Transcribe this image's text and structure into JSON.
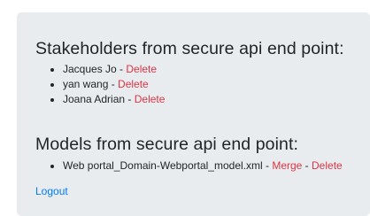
{
  "stakeholders": {
    "heading": "Stakeholders from secure api end point:",
    "items": [
      {
        "name": "Jacques Jo",
        "separator": " - ",
        "delete_label": "Delete"
      },
      {
        "name": "yan wang",
        "separator": " - ",
        "delete_label": "Delete"
      },
      {
        "name": "Joana Adrian",
        "separator": " - ",
        "delete_label": "Delete"
      }
    ]
  },
  "models": {
    "heading": "Models from secure api end point:",
    "items": [
      {
        "name": "Web portal_Domain-Webportal_model.xml",
        "separator1": " - ",
        "merge_label": "Merge",
        "separator2": " - ",
        "delete_label": "Delete"
      }
    ]
  },
  "logout_label": "Logout",
  "colors": {
    "panel_background": "#e9ecef",
    "text": "#212529",
    "danger_link": "#dc3545",
    "primary_link": "#007bff"
  }
}
